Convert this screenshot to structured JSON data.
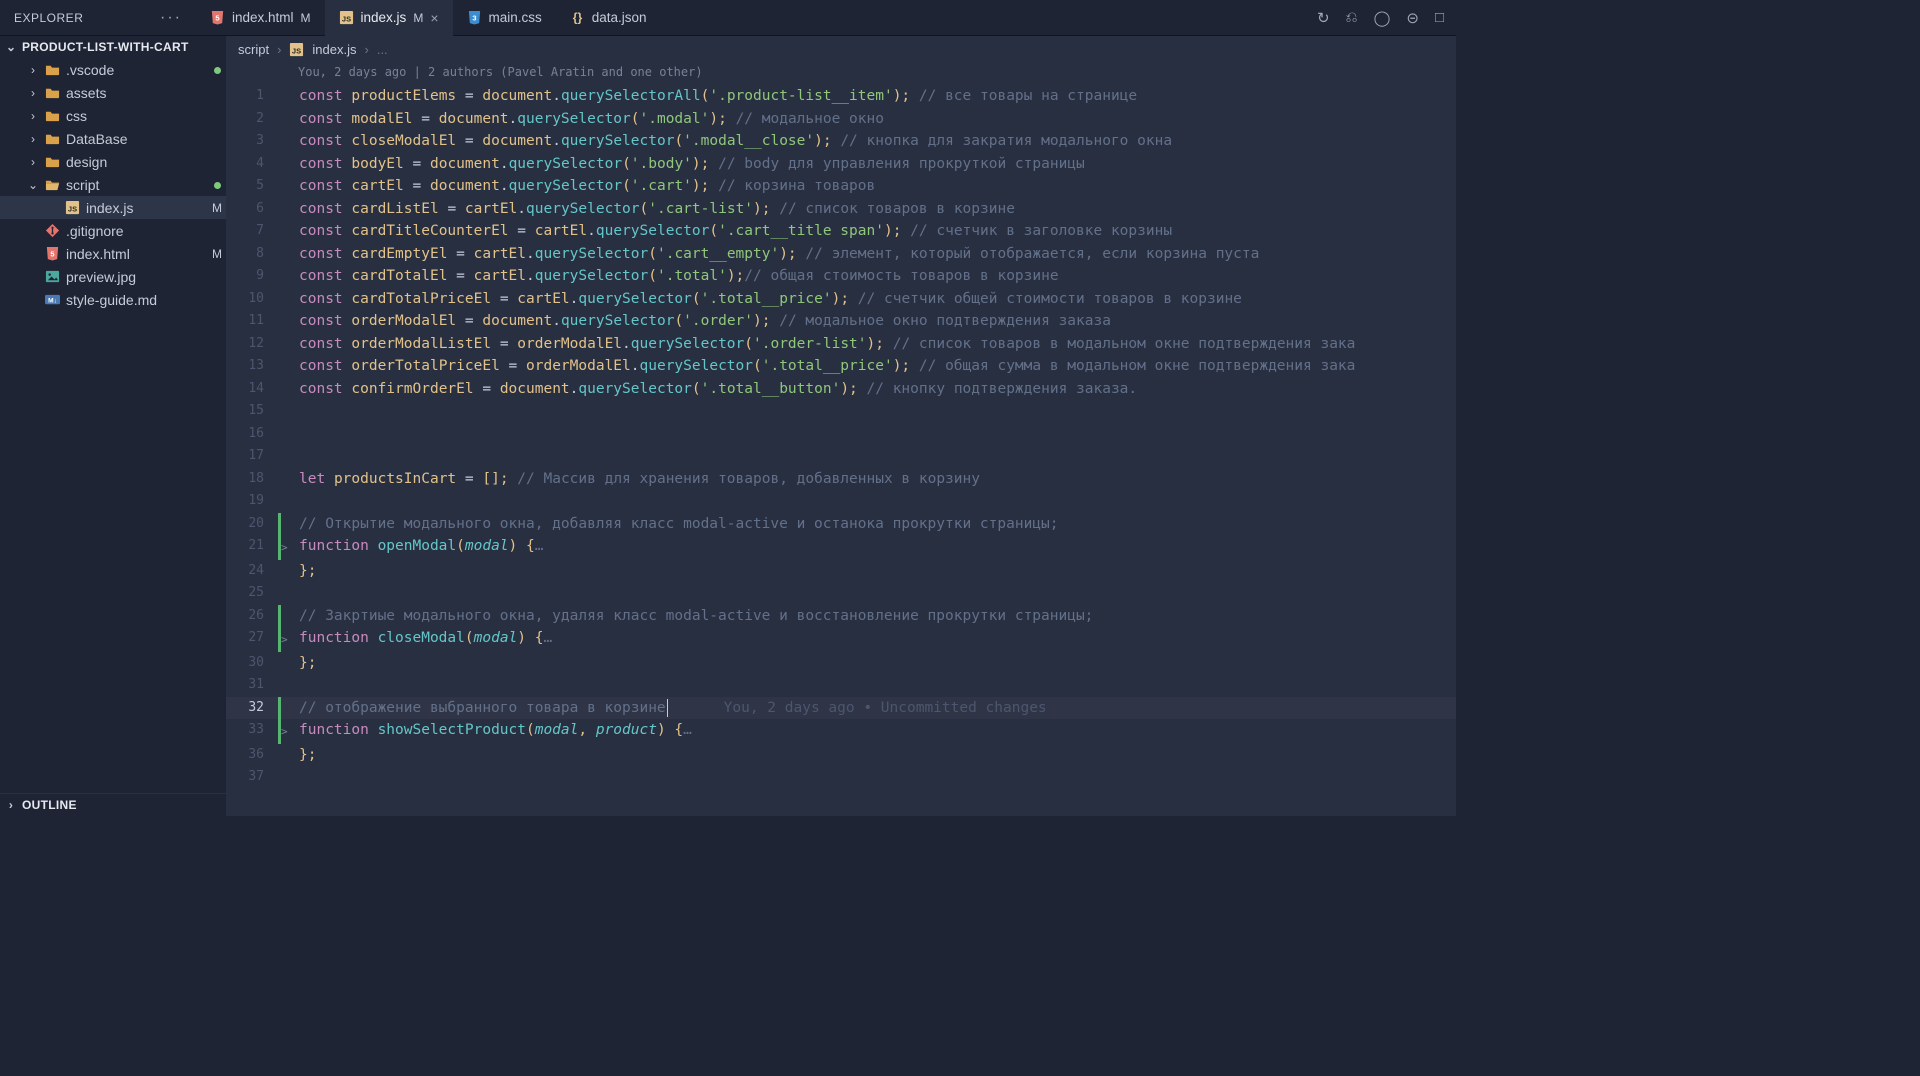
{
  "explorer": {
    "label": "EXPLORER"
  },
  "project_name": "PRODUCT-LIST-WITH-CART",
  "tabs": [
    {
      "file": "index.html",
      "mod": "M",
      "icon": "html5",
      "active": false
    },
    {
      "file": "index.js",
      "mod": "M",
      "icon": "js",
      "active": true
    },
    {
      "file": "main.css",
      "mod": "",
      "icon": "css",
      "active": false
    },
    {
      "file": "data.json",
      "mod": "",
      "icon": "json",
      "active": false
    }
  ],
  "title_actions": [
    "↻",
    "⎌",
    "◯",
    "⊝",
    "□"
  ],
  "tree": [
    {
      "name": ".vscode",
      "type": "folder",
      "level": 2,
      "open": false,
      "dot": true
    },
    {
      "name": "assets",
      "type": "folder",
      "level": 2,
      "open": false
    },
    {
      "name": "css",
      "type": "folder",
      "level": 2,
      "open": false
    },
    {
      "name": "DataBase",
      "type": "folder",
      "level": 2,
      "open": false
    },
    {
      "name": "design",
      "type": "folder",
      "level": 2,
      "open": false
    },
    {
      "name": "script",
      "type": "folder",
      "level": 2,
      "open": true,
      "dot": true
    },
    {
      "name": "index.js",
      "type": "js",
      "level": 3,
      "badge": "M",
      "active": true
    },
    {
      "name": ".gitignore",
      "type": "git",
      "level": 2
    },
    {
      "name": "index.html",
      "type": "html",
      "level": 2,
      "badge": "M"
    },
    {
      "name": "preview.jpg",
      "type": "img",
      "level": 2
    },
    {
      "name": "style-guide.md",
      "type": "md",
      "level": 2
    }
  ],
  "outline": "OUTLINE",
  "breadcrumb": {
    "a": "script",
    "b": "index.js",
    "c": "..."
  },
  "lens": "You, 2 days ago | 2 authors (Pavel Aratin and one other)",
  "inline_blame": "You, 2 days ago • Uncommitted changes",
  "code": {
    "lines": [
      {
        "n": 1,
        "bar": "",
        "html": "<span class='t-key'>const</span> <span class='t-var'>productElems</span> <span class='t-op'>=</span> <span class='t-obj'>document</span><span class='t-dot'>.</span><span class='t-fn'>querySelectorAll</span><span class='t-pun'>(</span><span class='t-str'>'.product-list__item'</span><span class='t-pun'>);</span> <span class='t-com'>// все товары на странице</span>"
      },
      {
        "n": 2,
        "bar": "",
        "html": "<span class='t-key'>const</span> <span class='t-var'>modalEl</span> <span class='t-op'>=</span> <span class='t-obj'>document</span><span class='t-dot'>.</span><span class='t-fn'>querySelector</span><span class='t-pun'>(</span><span class='t-str'>'.modal'</span><span class='t-pun'>);</span> <span class='t-com'>// модальное окно</span>"
      },
      {
        "n": 3,
        "bar": "",
        "html": "<span class='t-key'>const</span> <span class='t-var'>closeModalEl</span> <span class='t-op'>=</span> <span class='t-obj'>document</span><span class='t-dot'>.</span><span class='t-fn'>querySelector</span><span class='t-pun'>(</span><span class='t-str'>'.modal__close'</span><span class='t-pun'>);</span> <span class='t-com'>// кнопка для закратия модального окна</span>"
      },
      {
        "n": 4,
        "bar": "",
        "html": "<span class='t-key'>const</span> <span class='t-var'>bodyEl</span> <span class='t-op'>=</span> <span class='t-obj'>document</span><span class='t-dot'>.</span><span class='t-fn'>querySelector</span><span class='t-pun'>(</span><span class='t-str'>'.body'</span><span class='t-pun'>);</span> <span class='t-com'>// body для управления прокруткой страницы</span>"
      },
      {
        "n": 5,
        "bar": "",
        "html": "<span class='t-key'>const</span> <span class='t-var'>cartEl</span> <span class='t-op'>=</span> <span class='t-obj'>document</span><span class='t-dot'>.</span><span class='t-fn'>querySelector</span><span class='t-pun'>(</span><span class='t-str'>'.cart'</span><span class='t-pun'>);</span> <span class='t-com'>// корзина товаров</span>"
      },
      {
        "n": 6,
        "bar": "",
        "html": "<span class='t-key'>const</span> <span class='t-var'>cardListEl</span> <span class='t-op'>=</span> <span class='t-obj'>cartEl</span><span class='t-dot'>.</span><span class='t-fn'>querySelector</span><span class='t-pun'>(</span><span class='t-str'>'.cart-list'</span><span class='t-pun'>);</span> <span class='t-com'>// список товаров в корзине</span>"
      },
      {
        "n": 7,
        "bar": "",
        "html": "<span class='t-key'>const</span> <span class='t-var'>cardTitleCounterEl</span> <span class='t-op'>=</span> <span class='t-obj'>cartEl</span><span class='t-dot'>.</span><span class='t-fn'>querySelector</span><span class='t-pun'>(</span><span class='t-str'>'.cart__title span'</span><span class='t-pun'>);</span> <span class='t-com'>// счетчик в заголовке корзины</span>"
      },
      {
        "n": 8,
        "bar": "",
        "html": "<span class='t-key'>const</span> <span class='t-var'>cardEmptyEl</span> <span class='t-op'>=</span> <span class='t-obj'>cartEl</span><span class='t-dot'>.</span><span class='t-fn'>querySelector</span><span class='t-pun'>(</span><span class='t-str'>'.cart__empty'</span><span class='t-pun'>);</span> <span class='t-com'>// элемент, который отображается, если корзина пуста</span>"
      },
      {
        "n": 9,
        "bar": "",
        "html": "<span class='t-key'>const</span> <span class='t-var'>cardTotalEl</span> <span class='t-op'>=</span> <span class='t-obj'>cartEl</span><span class='t-dot'>.</span><span class='t-fn'>querySelector</span><span class='t-pun'>(</span><span class='t-str'>'.total'</span><span class='t-pun'>);</span><span class='t-com'>// общая стоимость товаров в корзине</span>"
      },
      {
        "n": 10,
        "bar": "",
        "html": "<span class='t-key'>const</span> <span class='t-var'>cardTotalPriceEl</span> <span class='t-op'>=</span> <span class='t-obj'>cartEl</span><span class='t-dot'>.</span><span class='t-fn'>querySelector</span><span class='t-pun'>(</span><span class='t-str'>'.total__price'</span><span class='t-pun'>);</span> <span class='t-com'>// счетчик общей стоимости товаров в корзине</span>"
      },
      {
        "n": 11,
        "bar": "",
        "html": "<span class='t-key'>const</span> <span class='t-var'>orderModalEl</span> <span class='t-op'>=</span> <span class='t-obj'>document</span><span class='t-dot'>.</span><span class='t-fn'>querySelector</span><span class='t-pun'>(</span><span class='t-str'>'.order'</span><span class='t-pun'>);</span> <span class='t-com'>// модальное окно подтверждения заказа</span>"
      },
      {
        "n": 12,
        "bar": "",
        "html": "<span class='t-key'>const</span> <span class='t-var'>orderModalListEl</span> <span class='t-op'>=</span> <span class='t-obj'>orderModalEl</span><span class='t-dot'>.</span><span class='t-fn'>querySelector</span><span class='t-pun'>(</span><span class='t-str'>'.order-list'</span><span class='t-pun'>);</span> <span class='t-com'>// список товаров в модальном окне подтверждения зака</span>"
      },
      {
        "n": 13,
        "bar": "",
        "html": "<span class='t-key'>const</span> <span class='t-var'>orderTotalPriceEl</span> <span class='t-op'>=</span> <span class='t-obj'>orderModalEl</span><span class='t-dot'>.</span><span class='t-fn'>querySelector</span><span class='t-pun'>(</span><span class='t-str'>'.total__price'</span><span class='t-pun'>);</span> <span class='t-com'>// общая сумма в модальном окне подтверждения зака</span>"
      },
      {
        "n": 14,
        "bar": "",
        "html": "<span class='t-key'>const</span> <span class='t-var'>confirmOrderEl</span> <span class='t-op'>=</span> <span class='t-obj'>document</span><span class='t-dot'>.</span><span class='t-fn'>querySelector</span><span class='t-pun'>(</span><span class='t-str'>'.total__button'</span><span class='t-pun'>);</span> <span class='t-com'>// кнопку подтверждения заказа.</span>"
      },
      {
        "n": 15,
        "bar": "",
        "html": ""
      },
      {
        "n": 16,
        "bar": "",
        "html": ""
      },
      {
        "n": 17,
        "bar": "",
        "html": ""
      },
      {
        "n": 18,
        "bar": "",
        "html": "<span class='t-key'>let</span> <span class='t-var'>productsInCart</span> <span class='t-op'>=</span> <span class='t-pun'>[];</span> <span class='t-com'>// Массив для хранения товаров, добавленных в корзину</span>"
      },
      {
        "n": 19,
        "bar": "",
        "html": ""
      },
      {
        "n": 20,
        "bar": "green",
        "html": "<span class='t-com'>// Открытие модального окна, добавляя класс modal-active и останока прокрутки страницы;</span>"
      },
      {
        "n": 21,
        "bar": "green",
        "fold": ">",
        "html": "<span class='t-key'>function</span> <span class='t-fname'>openModal</span><span class='t-pun'>(</span><span class='t-par'>modal</span><span class='t-pun'>)</span> <span class='t-pun'>{</span><span class='t-fold'>…</span>"
      },
      {
        "n": 24,
        "bar": "",
        "html": "<span class='t-pun'>};</span>"
      },
      {
        "n": 25,
        "bar": "",
        "html": ""
      },
      {
        "n": 26,
        "bar": "green",
        "html": "<span class='t-com'>// Закртиые модального окна, удаляя класс modal-active и восстановление прокрутки страницы;</span>"
      },
      {
        "n": 27,
        "bar": "green",
        "fold": ">",
        "html": "<span class='t-key'>function</span> <span class='t-fname'>closeModal</span><span class='t-pun'>(</span><span class='t-par'>modal</span><span class='t-pun'>)</span> <span class='t-pun'>{</span><span class='t-fold'>…</span>"
      },
      {
        "n": 30,
        "bar": "",
        "html": "<span class='t-pun'>};</span>"
      },
      {
        "n": 31,
        "bar": "",
        "html": ""
      },
      {
        "n": 32,
        "bar": "green",
        "cur": true,
        "html": "<span class='t-com'>// отображение выбранного товара в корзине</span><span class='cursor'></span><span class='inline-blame'>You, 2 days ago • Uncommitted changes</span>"
      },
      {
        "n": 33,
        "bar": "green",
        "fold": ">",
        "html": "<span class='t-key'>function</span> <span class='t-fname'>showSelectProduct</span><span class='t-pun'>(</span><span class='t-par'>modal</span><span class='t-pun'>,</span> <span class='t-par'>product</span><span class='t-pun'>)</span> <span class='t-pun'>{</span><span class='t-fold'>…</span>"
      },
      {
        "n": 36,
        "bar": "",
        "html": "<span class='t-pun'>};</span>"
      },
      {
        "n": 37,
        "bar": "",
        "html": ""
      }
    ]
  },
  "icons": {
    "folder_color": "#d9a14a",
    "js": "JS",
    "html": "5",
    "css": "3"
  }
}
